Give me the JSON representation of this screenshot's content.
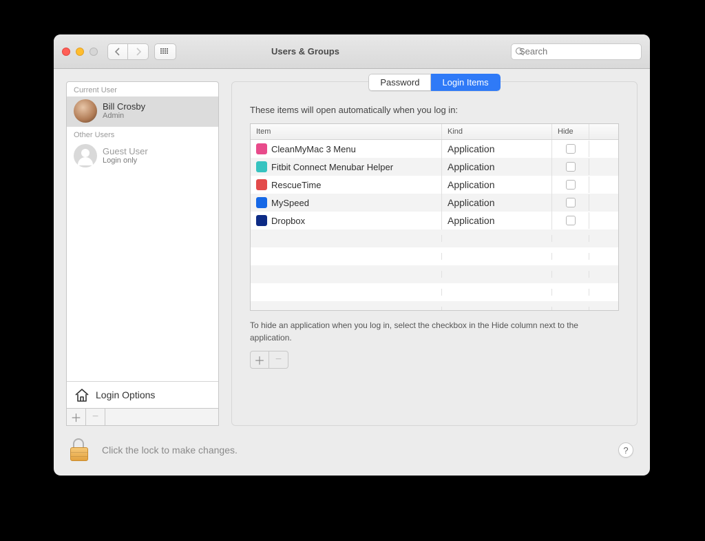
{
  "window": {
    "title": "Users & Groups"
  },
  "search": {
    "placeholder": "Search"
  },
  "sidebar": {
    "current_label": "Current User",
    "other_label": "Other Users",
    "current_user": {
      "name": "Bill Crosby",
      "role": "Admin"
    },
    "other_users": [
      {
        "name": "Guest User",
        "role": "Login only"
      }
    ],
    "login_options": "Login Options"
  },
  "tabs": {
    "password": "Password",
    "login_items": "Login Items"
  },
  "main": {
    "intro": "These items will open automatically when you log in:",
    "columns": {
      "item": "Item",
      "kind": "Kind",
      "hide": "Hide"
    },
    "rows": [
      {
        "name": "CleanMyMac 3 Menu",
        "kind": "Application",
        "icon_bg": "#e84b8b"
      },
      {
        "name": "Fitbit Connect Menubar Helper",
        "kind": "Application",
        "icon_bg": "#37c3c0"
      },
      {
        "name": "RescueTime",
        "kind": "Application",
        "icon_bg": "#e34b4b"
      },
      {
        "name": "MySpeed",
        "kind": "Application",
        "icon_bg": "#1668e6"
      },
      {
        "name": "Dropbox",
        "kind": "Application",
        "icon_bg": "#0d2b85"
      }
    ],
    "hint": "To hide an application when you log in, select the checkbox in the Hide column next to the application."
  },
  "footer": {
    "lock_text": "Click the lock to make changes."
  }
}
